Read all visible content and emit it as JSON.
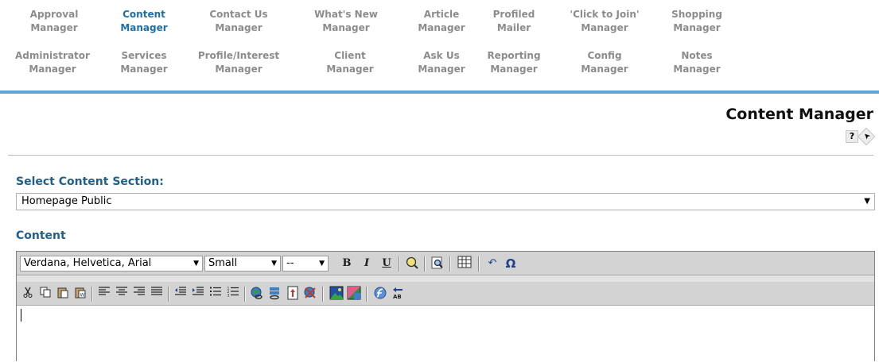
{
  "nav": {
    "row1": [
      {
        "line1": "Approval",
        "line2": "Manager"
      },
      {
        "line1": "Content",
        "line2": "Manager"
      },
      {
        "line1": "Contact Us",
        "line2": "Manager"
      },
      {
        "line1": "What's New",
        "line2": "Manager"
      },
      {
        "line1": "Article",
        "line2": "Manager"
      },
      {
        "line1": "Profiled",
        "line2": "Mailer"
      },
      {
        "line1": "'Click to Join'",
        "line2": "Manager"
      },
      {
        "line1": "Shopping",
        "line2": "Manager"
      }
    ],
    "row2": [
      {
        "line1": "Administrator",
        "line2": "Manager"
      },
      {
        "line1": "Services",
        "line2": "Manager"
      },
      {
        "line1": "Profile/Interest",
        "line2": "Manager"
      },
      {
        "line1": "Client",
        "line2": "Manager"
      },
      {
        "line1": "Ask Us",
        "line2": "Manager"
      },
      {
        "line1": "Reporting",
        "line2": "Manager"
      },
      {
        "line1": "Config",
        "line2": "Manager"
      },
      {
        "line1": "Notes",
        "line2": "Manager"
      }
    ],
    "active": "Content Manager"
  },
  "page": {
    "title": "Content Manager",
    "help_icon_glyph": "?",
    "pointer_icon_glyph": "➤"
  },
  "section": {
    "label": "Select Content Section:",
    "selected": "Homepage Public",
    "arrow": "▼"
  },
  "content": {
    "label": "Content"
  },
  "editor": {
    "font_family": "Verdana, Helvetica, Arial",
    "font_size": "Small",
    "format": "--",
    "dropdown_arrow": "▼",
    "bold": "B",
    "italic": "I",
    "underline": "U",
    "undo_glyph": "↶",
    "special_char_glyph": "Ω"
  },
  "colors": {
    "nav_active": "#1f6fa6",
    "nav_inactive": "#8c8c8c",
    "nav_rule": "#5ea7d4",
    "label_blue": "#1f5f8b",
    "toolbar_bg": "#d3d3d3"
  }
}
